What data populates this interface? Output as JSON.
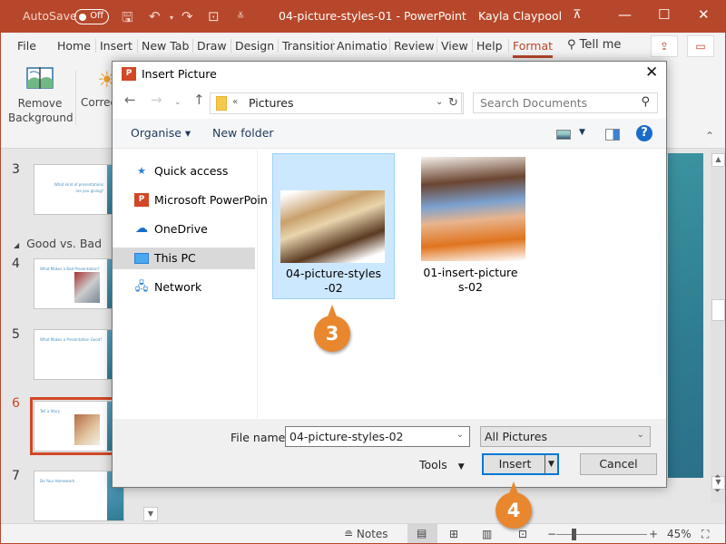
{
  "titlebar": {
    "autosave_label": "AutoSave",
    "autosave_state": "Off",
    "document_title": "04-picture-styles-01  -  PowerPoint",
    "user": "Kayla Claypool",
    "icons": [
      "save-icon",
      "undo-icon",
      "redo-icon",
      "present-icon",
      "customize-qat-icon"
    ]
  },
  "tabs": [
    "File",
    "Home",
    "Insert",
    "New Tab",
    "Draw",
    "Design",
    "Transitior",
    "Animatio",
    "Review",
    "View",
    "Help",
    "Format"
  ],
  "active_tab": "Format",
  "tellme": "Tell me",
  "ribbon": {
    "remove_background_line1": "Remove",
    "remove_background_line2": "Background",
    "corrections": "Correc"
  },
  "slides_pane": {
    "section": "Good vs. Bad",
    "slides": [
      {
        "number": "3",
        "title": "What kind of presentations are you giving?"
      },
      {
        "number": "4",
        "title": "What Makes a Bad Presentation?"
      },
      {
        "number": "5",
        "title": "What Makes a Presentation Good?"
      },
      {
        "number": "6",
        "title": "Tell a Story",
        "selected": true
      },
      {
        "number": "7",
        "title": "Do Your Homework"
      }
    ]
  },
  "dialog": {
    "title": "Insert Picture",
    "address": {
      "prefix": "«",
      "folder": "Pictures"
    },
    "search_placeholder": "Search Documents",
    "organise": "Organise ▾",
    "new_folder": "New folder",
    "help": "?",
    "nav_items": [
      {
        "label": "Quick access",
        "icon": "quick-access-icon"
      },
      {
        "label": "Microsoft PowerPoin",
        "icon": "powerpoint-icon"
      },
      {
        "label": "OneDrive",
        "icon": "onedrive-icon"
      },
      {
        "label": "This PC",
        "icon": "this-pc-icon",
        "selected": true
      },
      {
        "label": "Network",
        "icon": "network-icon"
      }
    ],
    "files": [
      {
        "name_line1": "04-picture-styles",
        "name_line2": "-02",
        "selected": true
      },
      {
        "name_line1": "01-insert-picture",
        "name_line2": "s-02",
        "selected": false
      }
    ],
    "file_name_label": "File name:",
    "file_name_value": "04-picture-styles-02",
    "file_type": "All Pictures",
    "tools": "Tools",
    "insert": "Insert",
    "cancel": "Cancel"
  },
  "callouts": {
    "step3": "3",
    "step4": "4"
  },
  "statusbar": {
    "notes": "Notes",
    "zoom": "45%",
    "zoom_percent": 45
  }
}
